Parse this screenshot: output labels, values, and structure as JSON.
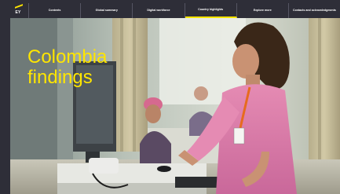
{
  "brand": {
    "logo_text": "EY",
    "accent": "#ffe600"
  },
  "nav": {
    "items": [
      {
        "label": "Contents"
      },
      {
        "label": "Global summary"
      },
      {
        "label": "Digital workforce"
      },
      {
        "label": "Country highlights"
      },
      {
        "label": "Explore more"
      },
      {
        "label": "Contacts and acknowledgments"
      }
    ],
    "active_index": 3
  },
  "hero": {
    "title": "Colombia findings"
  },
  "colors": {
    "background": "#2e2e38",
    "nav_divider": "#555563",
    "title": "#ffe600"
  }
}
